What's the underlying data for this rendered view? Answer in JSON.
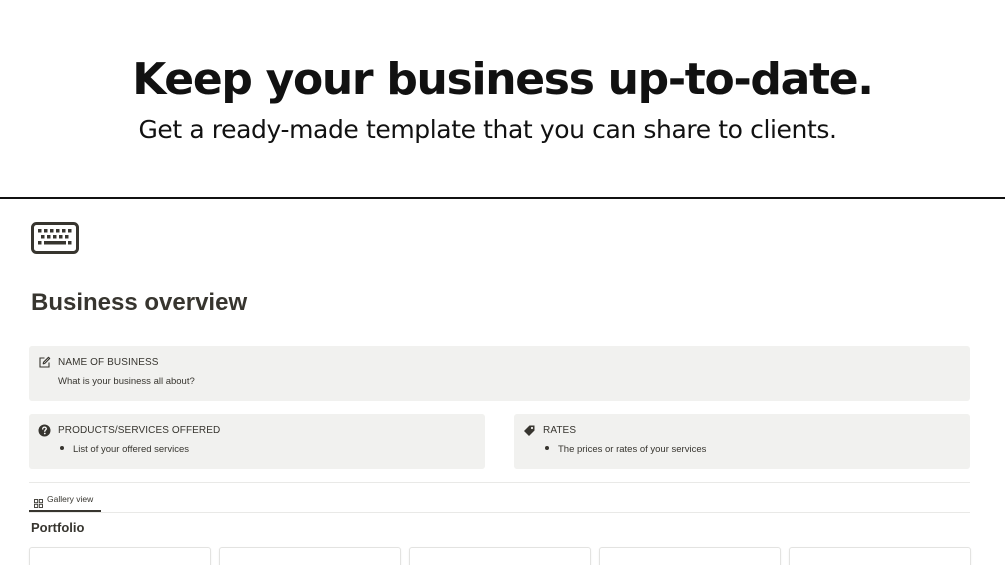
{
  "hero": {
    "title": "Keep your business up-to-date.",
    "subtitle": "Get a ready-made template that you can share to clients."
  },
  "page": {
    "icon": "keyboard-icon",
    "title": "Business overview"
  },
  "callouts": {
    "name": {
      "icon": "edit-icon",
      "heading": "NAME OF BUSINESS",
      "text": "What is your business all about?"
    },
    "products": {
      "icon": "question-circle-icon",
      "heading": "PRODUCTS/SERVICES OFFERED",
      "bullet": "List of your offered services"
    },
    "rates": {
      "icon": "tag-icon",
      "heading": "RATES",
      "bullet": "The prices or rates of your services"
    }
  },
  "database": {
    "view_tab": {
      "icon": "gallery-grid-icon",
      "label": "Gallery view"
    },
    "title": "Portfolio",
    "card_count_visible": 5
  },
  "colors": {
    "text": "#37352f",
    "callout_bg": "#f1f1ef",
    "divider": "#111111",
    "border": "#e9e9e7"
  }
}
